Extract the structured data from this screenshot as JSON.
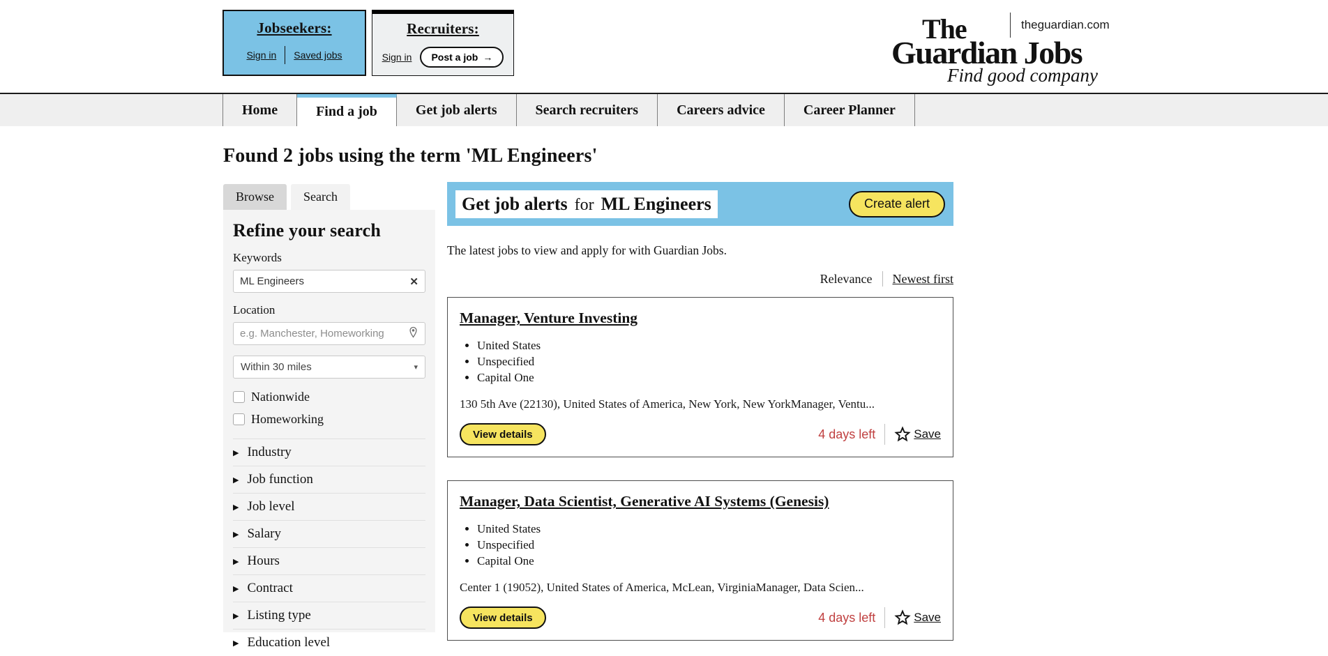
{
  "header": {
    "jobseekers": {
      "title": "Jobseekers:",
      "sign_in": "Sign in",
      "saved_jobs": "Saved jobs"
    },
    "recruiters": {
      "title": "Recruiters:",
      "sign_in": "Sign in",
      "post_job": "Post a job",
      "arrow": "→"
    },
    "domain": "theguardian.com",
    "logo": {
      "the": "The",
      "name": "Guardian Jobs",
      "tagline": "Find good company"
    }
  },
  "nav": {
    "items": [
      "Home",
      "Find a job",
      "Get job alerts",
      "Search recruiters",
      "Careers advice",
      "Career Planner"
    ],
    "active": "Find a job"
  },
  "page": {
    "results_heading": "Found 2 jobs using the term 'ML Engineers'"
  },
  "sidebar": {
    "tabs": {
      "browse": "Browse",
      "search": "Search"
    },
    "refine_title": "Refine your search",
    "keywords": {
      "label": "Keywords",
      "value": "ML Engineers",
      "clear_icon": "✕"
    },
    "location": {
      "label": "Location",
      "placeholder": "e.g. Manchester, Homeworking"
    },
    "radius": {
      "value": "Within 30 miles",
      "chevron": "▾"
    },
    "checkboxes": [
      {
        "label": "Nationwide",
        "checked": false
      },
      {
        "label": "Homeworking",
        "checked": false
      }
    ],
    "filters": [
      "Industry",
      "Job function",
      "Job level",
      "Salary",
      "Hours",
      "Contract",
      "Listing type",
      "Education level"
    ],
    "filter_arrow": "▶"
  },
  "main": {
    "alert_banner": {
      "prefix": "Get job alerts",
      "for": "for",
      "term": "ML Engineers",
      "button": "Create alert"
    },
    "intro": "The latest jobs to view and apply for with Guardian Jobs.",
    "sort": {
      "relevance": "Relevance",
      "newest": "Newest first"
    },
    "jobs": [
      {
        "title": "Manager, Venture Investing",
        "bullets": [
          "United States",
          "Unspecified",
          "Capital One"
        ],
        "description": "130 5th Ave (22130), United States of America, New York, New YorkManager, Ventu...",
        "view_details": "View details",
        "days_left": "4 days left",
        "save": "Save"
      },
      {
        "title": "Manager, Data Scientist, Generative AI Systems (Genesis)",
        "bullets": [
          "United States",
          "Unspecified",
          "Capital One"
        ],
        "description": "Center 1 (19052), United States of America, McLean, VirginiaManager, Data Scien...",
        "view_details": "View details",
        "days_left": "4 days left",
        "save": "Save"
      }
    ]
  },
  "colors": {
    "accent_blue": "#7bc2e5",
    "button_yellow": "#f6e45f",
    "days_red": "#c04040"
  }
}
